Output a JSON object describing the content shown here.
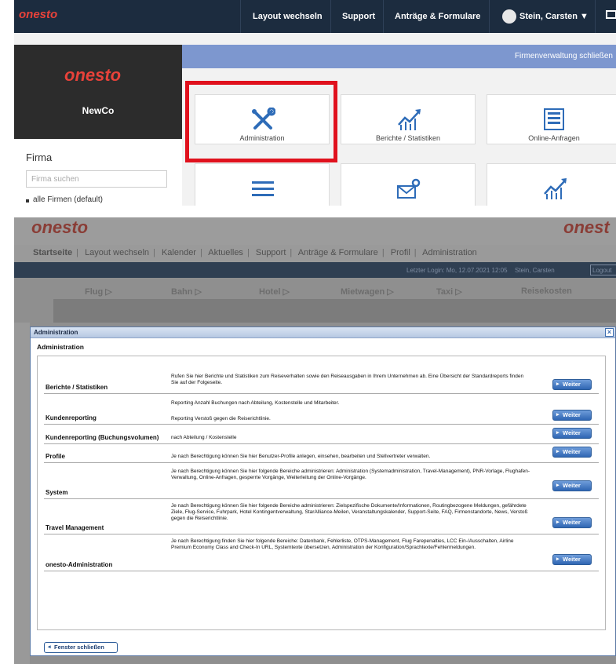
{
  "top": {
    "logo": "onesto",
    "nav": [
      "Layout wechseln",
      "Support",
      "Anträge & Formulare"
    ],
    "user": "Stein, Carsten",
    "brand": "onesto",
    "company": "NewCo",
    "firma_label": "Firma",
    "firma_placeholder": "Firma suchen",
    "all_firms": "alle Firmen (default)",
    "close_admin": "Firmenverwaltung schließen",
    "tiles": [
      "Administration",
      "Berichte / Statistiken",
      "Online-Anfragen"
    ],
    "highlight_color": "#e0111d"
  },
  "bottom": {
    "bg_logo": "onesto",
    "bg_logo_right": "onest",
    "bg_menu": [
      "Startseite",
      "Layout wechseln",
      "Kalender",
      "Aktuelles",
      "Support",
      "Anträge & Formulare",
      "Profil",
      "Administration"
    ],
    "bg_login": "Letzter Login: Mo, 12.07.2021 12:05",
    "bg_user": "Stein, Carsten",
    "bg_logout": "Logout",
    "bg_tabs": [
      "Flug ▷",
      "Bahn ▷",
      "Hotel ▷",
      "Mietwagen ▷",
      "Taxi ▷",
      "Reisekosten"
    ],
    "dialog": {
      "title": "Administration",
      "subtitle": "Administration",
      "rows": [
        {
          "name": "Berichte / Statistiken",
          "desc": "Rufen Sie hier Berichte und Statistiken zum Reiseverhalten sowie den Reiseausgaben in Ihrem Unternehmen ab. Eine Übersicht der Standardreports finden Sie auf der Folgeseite.",
          "button": "Weiter"
        },
        {
          "name": "Kundenreporting",
          "desc": "Reporting Anzahl Buchungen nach Abteilung, Kostenstelle und Mitarbeiter.",
          "desc2": "Reporting Verstoß gegen die Reiserichtlinie.",
          "button": "Weiter"
        },
        {
          "name": "Kundenreporting (Buchungsvolumen)",
          "desc": "nach Abteilung / Kostenstelle",
          "button": "Weiter"
        },
        {
          "name": "Profile",
          "desc": "Je nach Berechtigung können Sie hier Benutzer-Profile anlegen, einsehen, bearbeiten und Stellvertreter verwalten.",
          "button": "Weiter"
        },
        {
          "name": "System",
          "desc": "Je nach Berechtigung können Sie hier folgende Bereiche administrieren: Administration (Systemadministration, Travel-Management), PNR-Vorlage, Flughafen-Verwaltung, Online-Anfragen, gesperrte Vorgänge, Weiterleitung der Online-Vorgänge.",
          "button": "Weiter"
        },
        {
          "name": "Travel Management",
          "desc": "Je nach Berechtigung können Sie hier folgende Bereiche administrieren: Zielspezifische Dokumente/Informationen, Routingbezogene Meldungen, gefährdete Ziele, Flug-Service, Fuhrpark, Hotel Kontingentverwaltung, StarAlliance-Meilen, Veranstaltungskalender, Support-Seite, FAQ, Firmenstandorte, News, Verstoß gegen die Reiserichtlinie.",
          "button": "Weiter"
        },
        {
          "name": "onesto-Administration",
          "desc": "Je nach Berechtigung finden Sie hier folgende Bereiche: Datenbank, Fehlerliste, OTPS-Management, Flug Farepenalties, LCC Ein-/Ausschalten, Airline Premium Economy Class and Check-In URL, Systemtexte übersetzen, Administration der Konfiguration/Sprachtexte/Fehlermeldungen.",
          "button": "Weiter"
        }
      ],
      "close_button": "Fenster schließen"
    }
  }
}
